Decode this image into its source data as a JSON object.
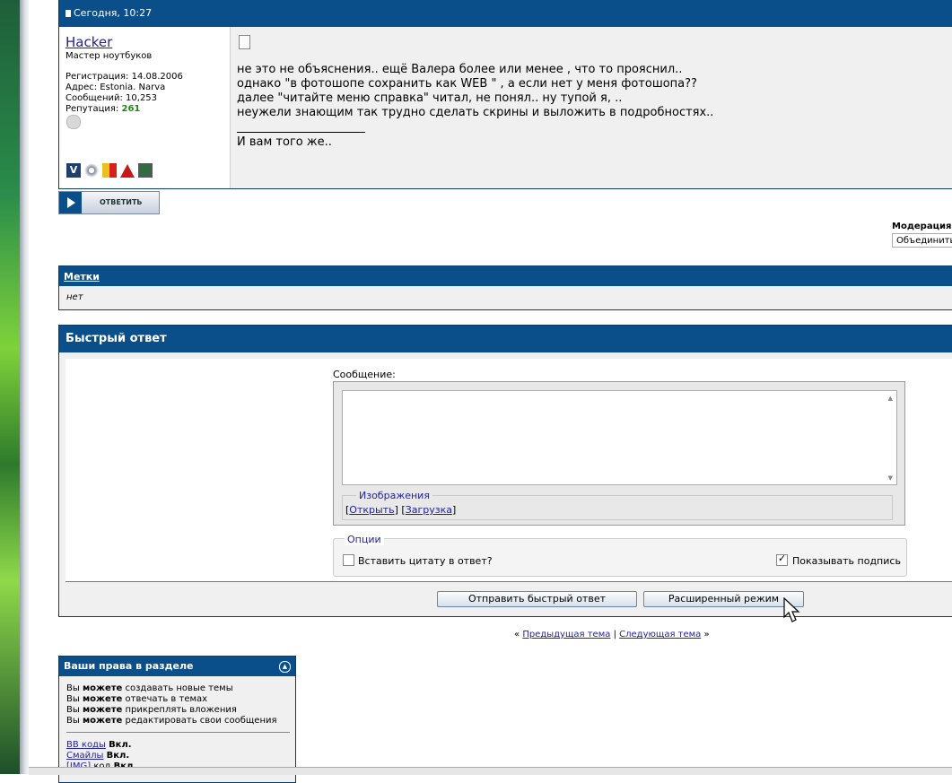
{
  "post": {
    "date": "Сегодня, 10:27",
    "username": "Hacker",
    "user_title": "Мастер ноутбуков",
    "registration": "Регистрация: 14.08.2006",
    "address": "Адрес: Estonia. Narva",
    "messages": "Сообщений: 10,253",
    "reputation_label": "Репутация:",
    "reputation_value": "261",
    "lines": [
      "не это не объяснения.. ещё Валера более или менее , что то прояснил..",
      "однако \"в фотошопе сохранить как WEB \" , а если нет у меня фотошопа??",
      "далее \"читайте меню справка\" читал, не понял.. ну тупой я, ..",
      "неужели знающим так трудно сделать скрины и выложить в подробностях.."
    ],
    "signature": "И вам того же..",
    "badge_v": "V"
  },
  "reply_button_label": "ОТВЕТИТЬ",
  "moderation": {
    "label": "Модерация",
    "selected": "Объединить"
  },
  "tags": {
    "title": "Метки",
    "value": "нет"
  },
  "quick_reply": {
    "title": "Быстрый ответ",
    "message_label": "Сообщение:",
    "images_legend": "Изображения",
    "images_open": "Открыть",
    "images_upload": "Загрузка",
    "options_legend": "Опции",
    "quote_label": "Вставить цитату в ответ?",
    "quote_checked": false,
    "signature_label": "Показывать подпись",
    "signature_checked": true,
    "send_button": "Отправить быстрый ответ",
    "advanced_button": "Расширенный режим"
  },
  "nav": {
    "prev": "Предыдущая тема",
    "next": "Следующая тема",
    "sep": "|",
    "left_mark": "«",
    "right_mark": "»"
  },
  "rights": {
    "title": "Ваши права в разделе",
    "you": "Вы",
    "can": "можете",
    "items": [
      "создавать новые темы",
      "отвечать в темах",
      "прикреплять вложения",
      "редактировать свои сообщения"
    ],
    "codes": [
      {
        "link": "BB коды",
        "state": "Вкл."
      },
      {
        "link": "Смайлы",
        "state": "Вкл."
      },
      {
        "link": "[IMG]",
        "suffix": "код",
        "state": "Вкл."
      }
    ]
  }
}
